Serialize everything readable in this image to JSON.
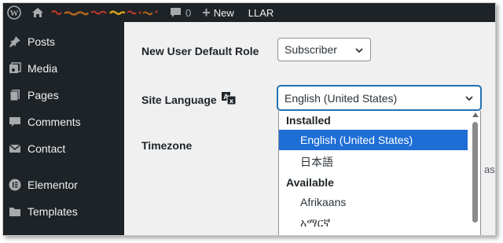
{
  "adminbar": {
    "comments_count": "0",
    "new_label": "New",
    "plugin_label": "LLAR"
  },
  "sidebar": {
    "items": [
      {
        "label": "Posts",
        "icon": "pushpin-icon"
      },
      {
        "label": "Media",
        "icon": "media-icon"
      },
      {
        "label": "Pages",
        "icon": "pages-icon"
      },
      {
        "label": "Comments",
        "icon": "comment-icon"
      },
      {
        "label": "Contact",
        "icon": "envelope-icon"
      },
      {
        "label": "Elementor",
        "icon": "elementor-icon"
      },
      {
        "label": "Templates",
        "icon": "folder-icon"
      }
    ]
  },
  "settings": {
    "default_role_label": "New User Default Role",
    "default_role_value": "Subscriber",
    "site_language_label": "Site Language",
    "site_language_value": "English (United States)",
    "timezone_label": "Timezone",
    "trailing_text": "as"
  },
  "language_dropdown": {
    "installed_label": "Installed",
    "installed": [
      "English (United States)",
      "日本語"
    ],
    "available_label": "Available",
    "available": [
      "Afrikaans",
      "አማርኛ"
    ],
    "selected": "English (United States)"
  },
  "colors": {
    "adminbar_bg": "#1d2327",
    "accent": "#2271b1",
    "selected_option": "#1e6ed6"
  }
}
